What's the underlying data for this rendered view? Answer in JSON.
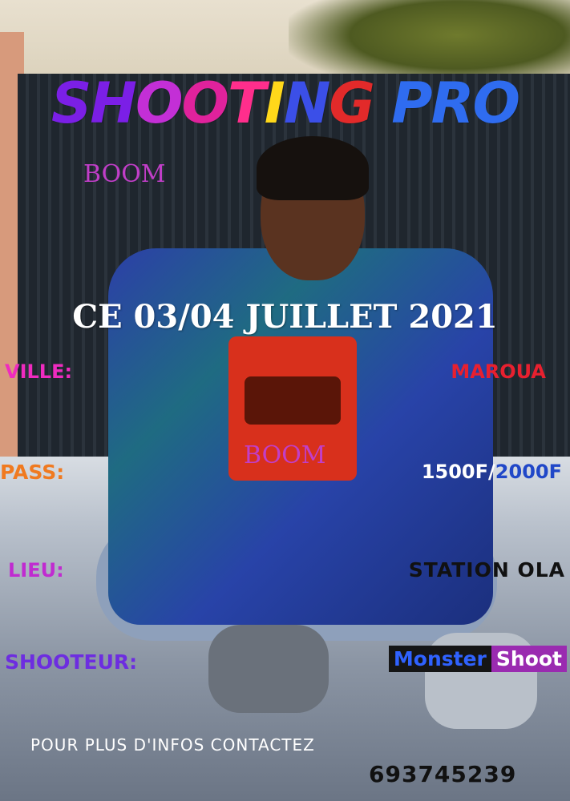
{
  "poster": {
    "title_letters": [
      {
        "char": "S",
        "color": "#7b1fe6"
      },
      {
        "char": "H",
        "color": "#7b1fe6"
      },
      {
        "char": "O",
        "color": "#c32fd6"
      },
      {
        "char": "O",
        "color": "#e0229c"
      },
      {
        "char": "T",
        "color": "#ff2e8c"
      },
      {
        "char": "I",
        "color": "#ffd81a"
      },
      {
        "char": "N",
        "color": "#3b4fe8"
      },
      {
        "char": "G",
        "color": "#e22a2a"
      },
      {
        "char": " ",
        "color": "#000000"
      },
      {
        "char": "P",
        "color": "#2f6cf0"
      },
      {
        "char": "R",
        "color": "#2f6cf0"
      },
      {
        "char": "O",
        "color": "#2f6cf0"
      }
    ],
    "title": "SHOOTING PRO",
    "boom_top": "BOOM",
    "date": "CE 03/04 JUILLET 2021",
    "ville_label": "VILLE:",
    "ville_value": "MAROUA",
    "pass_label": "PASS:",
    "pass_value_a": "1500F/",
    "pass_value_b": "2000F",
    "boom_mid": "BOOM",
    "lieu_label": "LIEU:",
    "lieu_value": "STATION OLA",
    "shooteur_label": "SHOOTEUR:",
    "shooteur_value_a": "Monster",
    "shooteur_value_b": "Shoot",
    "contact_text": "POUR PLUS D'INFOS CONTACTEZ",
    "phone": "693745239"
  }
}
